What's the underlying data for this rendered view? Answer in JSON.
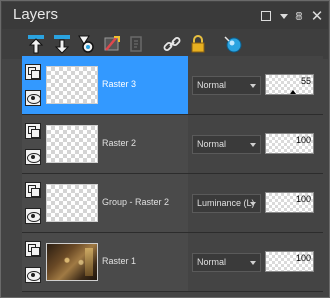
{
  "window": {
    "title": "Layers"
  },
  "toolbar": {
    "tools": [
      {
        "icon": "new-raster-layer-icon"
      },
      {
        "icon": "new-vector-layer-icon"
      },
      {
        "icon": "new-adjustment-layer-icon"
      },
      {
        "icon": "new-mask-layer-icon"
      },
      {
        "icon": "layer-properties-icon"
      },
      {
        "icon": "link-icon"
      },
      {
        "icon": "lock-icon"
      },
      {
        "icon": "layer-style-icon"
      }
    ]
  },
  "layers": [
    {
      "name": "Raster 3",
      "blend_mode": "Normal",
      "opacity": "55",
      "opacity_value": 55,
      "selected": true,
      "thumbnail": "transparent"
    },
    {
      "name": "Raster 2",
      "blend_mode": "Normal",
      "opacity": "100",
      "opacity_value": 100,
      "selected": false,
      "thumbnail": "transparent"
    },
    {
      "name": "Group - Raster 2",
      "blend_mode": "Luminance (L)",
      "opacity": "100",
      "opacity_value": 100,
      "selected": false,
      "thumbnail": "transparent"
    },
    {
      "name": "Raster 1",
      "blend_mode": "Normal",
      "opacity": "100",
      "opacity_value": 100,
      "selected": false,
      "thumbnail": "photo"
    }
  ],
  "colors": {
    "selection": "#3399ff",
    "panel": "#444444"
  }
}
